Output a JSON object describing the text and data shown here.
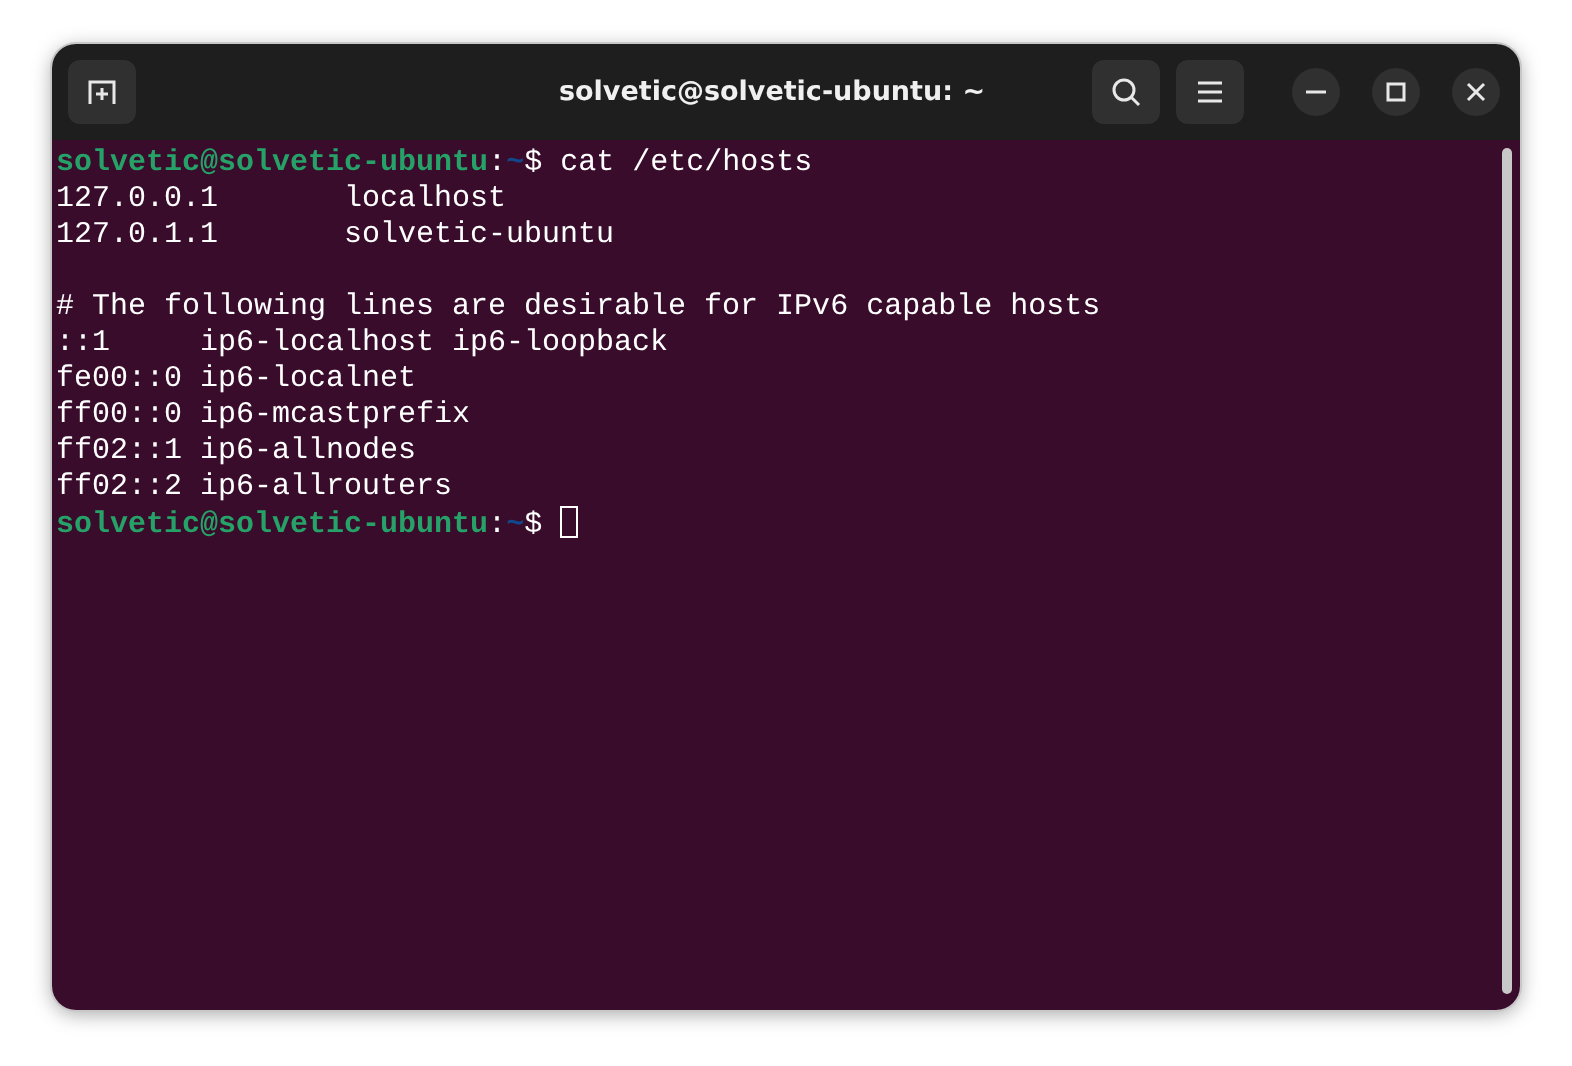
{
  "window": {
    "title": "solvetic@solvetic-ubuntu: ~"
  },
  "terminal": {
    "lines": [
      {
        "kind": "prompt",
        "user": "solvetic@solvetic-ubuntu",
        "separator": ":",
        "path": "~",
        "symbol": "$",
        "command": "cat /etc/hosts",
        "cursor": false
      },
      {
        "kind": "output",
        "text": "127.0.0.1       localhost"
      },
      {
        "kind": "output",
        "text": "127.0.1.1       solvetic-ubuntu"
      },
      {
        "kind": "blank"
      },
      {
        "kind": "output",
        "text": "# The following lines are desirable for IPv6 capable hosts"
      },
      {
        "kind": "output",
        "text": "::1     ip6-localhost ip6-loopback"
      },
      {
        "kind": "output",
        "text": "fe00::0 ip6-localnet"
      },
      {
        "kind": "output",
        "text": "ff00::0 ip6-mcastprefix"
      },
      {
        "kind": "output",
        "text": "ff02::1 ip6-allnodes"
      },
      {
        "kind": "output",
        "text": "ff02::2 ip6-allrouters"
      },
      {
        "kind": "prompt",
        "user": "solvetic@solvetic-ubuntu",
        "separator": ":",
        "path": "~",
        "symbol": "$",
        "cursor": true
      }
    ]
  }
}
